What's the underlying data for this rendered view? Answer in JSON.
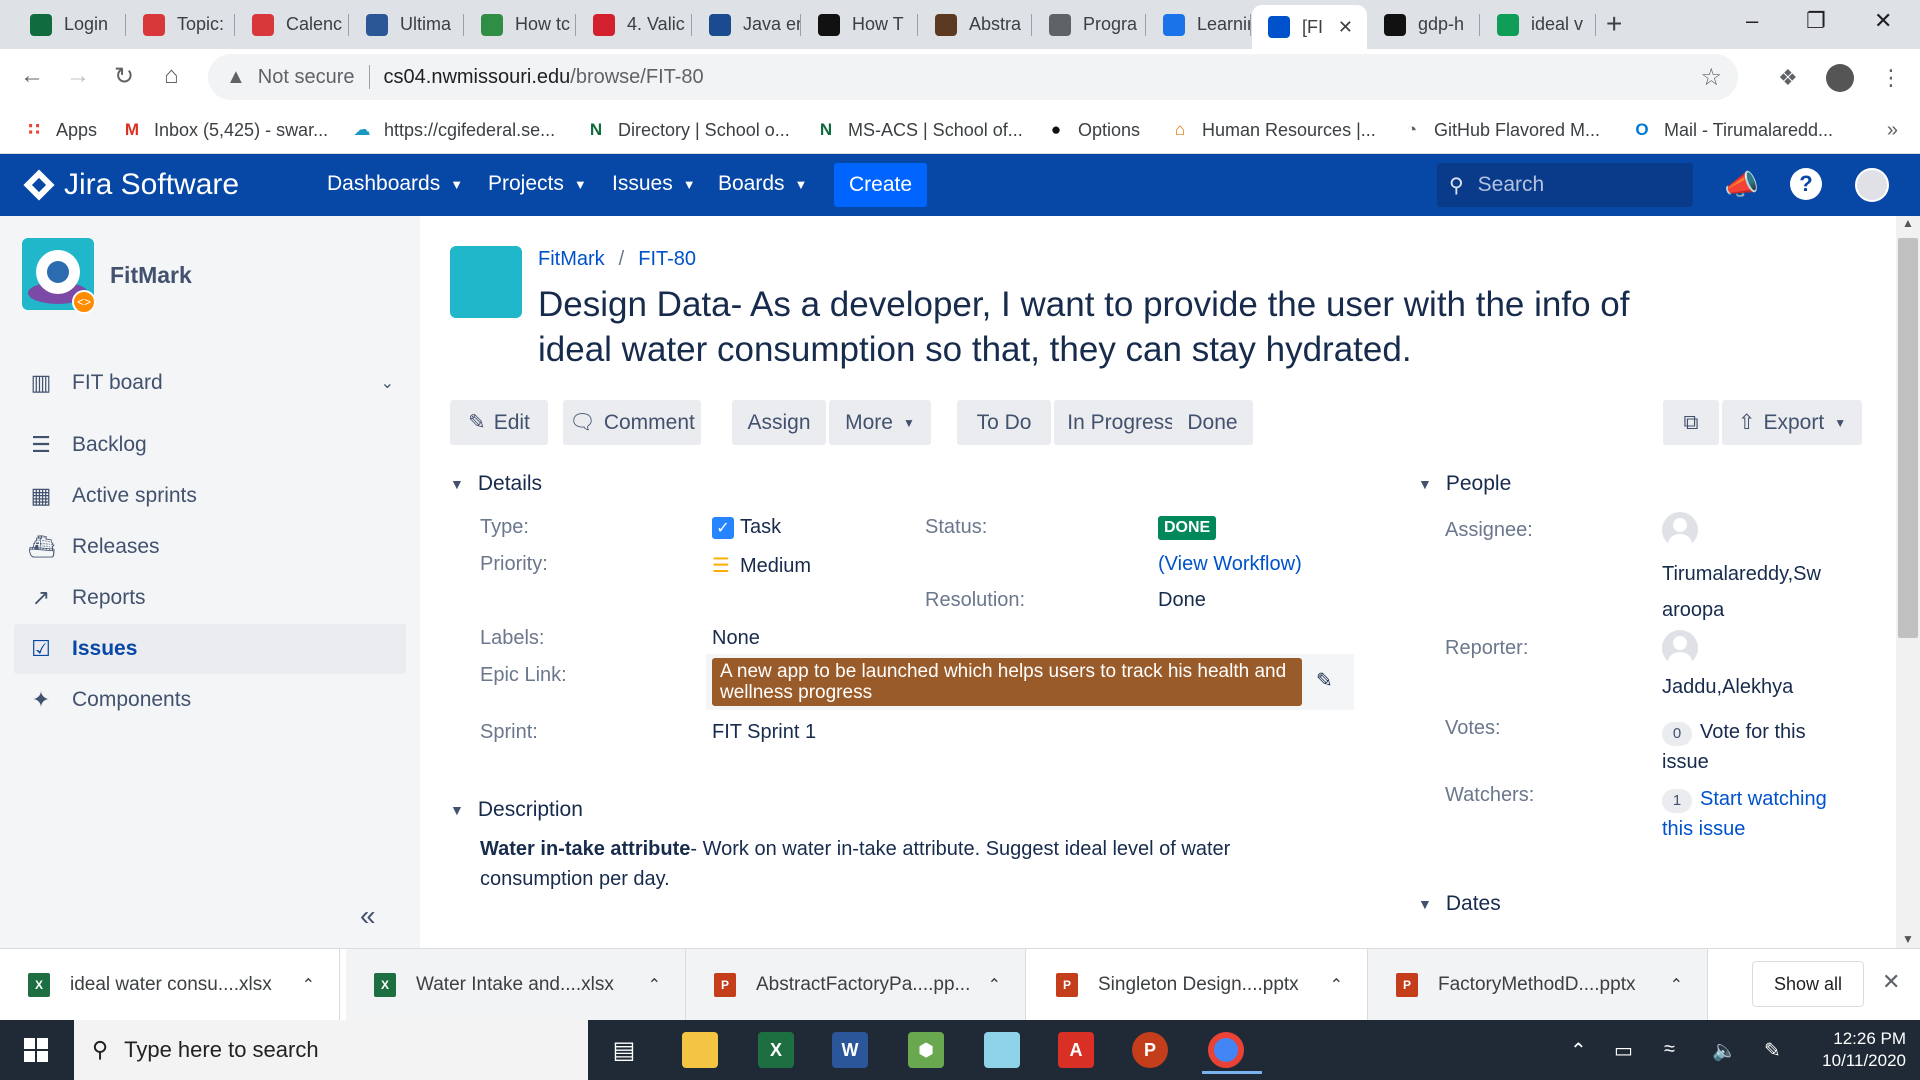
{
  "browser": {
    "tabs": [
      {
        "title": "Login",
        "icon": "notion-icon",
        "color": "#106b3d"
      },
      {
        "title": "Topic:",
        "icon": "northwest-icon",
        "color": "#d9383b"
      },
      {
        "title": "Calenc",
        "icon": "northwest-icon",
        "color": "#d9383b"
      },
      {
        "title": "Ultima",
        "icon": "atom-icon",
        "color": "#2b5797"
      },
      {
        "title": "How tc",
        "icon": "geeks-icon",
        "color": "#2f8d46"
      },
      {
        "title": "4. Valic",
        "icon": "opera-icon",
        "color": "#d3202f"
      },
      {
        "title": "Java er",
        "icon": "app-icon",
        "color": "#1b4b8f"
      },
      {
        "title": "How T",
        "icon": "heart-icon",
        "color": "#111111"
      },
      {
        "title": "Abstra",
        "icon": "dragon-icon",
        "color": "#5c3a21"
      },
      {
        "title": "Progra",
        "icon": "globe-icon",
        "color": "#5f6368"
      },
      {
        "title": "Learnir",
        "icon": "dot-icon",
        "color": "#1a73e8"
      },
      {
        "title": "[FI",
        "icon": "jira-icon",
        "color": "#0052cc"
      },
      {
        "title": "gdp-h",
        "icon": "github-icon",
        "color": "#111111"
      },
      {
        "title": "ideal v",
        "icon": "sheets-icon",
        "color": "#0f9d58"
      }
    ],
    "new_tab": "+",
    "url_warning": "Not secure",
    "url_host": "cs04.nwmissouri.edu",
    "url_path": "/browse/FIT-80",
    "bookmarks": [
      {
        "label": "Apps",
        "icon": "apps-grid-icon",
        "color": "#ea4335"
      },
      {
        "label": "Inbox (5,425) - swar...",
        "icon": "gmail-icon",
        "color": "#d93025"
      },
      {
        "label": "https://cgifederal.se...",
        "icon": "salesforce-icon",
        "color": "#1798c1"
      },
      {
        "label": "Directory | School o...",
        "icon": "n-icon",
        "color": "#106b3d"
      },
      {
        "label": "MS-ACS | School of...",
        "icon": "n-icon",
        "color": "#106b3d"
      },
      {
        "label": "Options",
        "icon": "github-icon",
        "color": "#111111"
      },
      {
        "label": "Human Resources |...",
        "icon": "hr-icon",
        "color": "#e8710a"
      },
      {
        "label": "GitHub Flavored M...",
        "icon": "globe-icon",
        "color": "#5f6368"
      },
      {
        "label": "Mail - Tirumalaredd...",
        "icon": "outlook-icon",
        "color": "#0078d4"
      }
    ]
  },
  "jira": {
    "brand": "Jira Software",
    "nav": [
      "Dashboards",
      "Projects",
      "Issues",
      "Boards"
    ],
    "create": "Create",
    "search_placeholder": "Search",
    "colors": {
      "header": "#0747a6",
      "create": "#0065ff",
      "done": "#00875a",
      "epic": "#9a5b2a"
    }
  },
  "sidebar": {
    "project": "FitMark",
    "items": [
      {
        "label": "FIT board",
        "icon": "board-icon"
      },
      {
        "label": "Backlog",
        "icon": "backlog-icon"
      },
      {
        "label": "Active sprints",
        "icon": "sprint-board-icon"
      },
      {
        "label": "Releases",
        "icon": "ship-icon"
      },
      {
        "label": "Reports",
        "icon": "chart-icon"
      },
      {
        "label": "Issues",
        "icon": "issues-icon",
        "selected": true
      },
      {
        "label": "Components",
        "icon": "puzzle-icon"
      }
    ]
  },
  "issue": {
    "project": "FitMark",
    "key": "FIT-80",
    "summary": "Design Data- As a developer, I want to provide the user with the info of ideal water consumption so that, they can stay hydrated.",
    "ops": {
      "edit": "Edit",
      "comment": "Comment",
      "assign": "Assign",
      "more": "More",
      "todo": "To Do",
      "inprogress": "In Progress",
      "done": "Done",
      "export": "Export"
    },
    "details": {
      "heading": "Details",
      "type_label": "Type:",
      "type": "Task",
      "priority_label": "Priority:",
      "priority": "Medium",
      "status_label": "Status:",
      "status": "DONE",
      "workflow": "(View Workflow)",
      "resolution_label": "Resolution:",
      "resolution": "Done",
      "labels_label": "Labels:",
      "labels": "None",
      "epic_label": "Epic Link:",
      "epic": "A new app to be launched which helps users to track his health and wellness progress",
      "sprint_label": "Sprint:",
      "sprint": "FIT Sprint 1"
    },
    "description": {
      "heading": "Description",
      "bold": "Water in-take attribute",
      "text": "- Work on water in-take attribute. Suggest ideal level of water consumption per day."
    },
    "people": {
      "heading": "People",
      "assignee_label": "Assignee:",
      "assignee": "Tirumalareddy,Swaroopa",
      "reporter_label": "Reporter:",
      "reporter": "Jaddu,Alekhya",
      "votes_label": "Votes:",
      "votes": "0",
      "vote_text": "Vote for this issue",
      "watchers_label": "Watchers:",
      "watchers": "1",
      "watch_text": "Start watching this issue"
    },
    "dates_heading": "Dates"
  },
  "downloads": {
    "items": [
      {
        "name": "ideal water consu....xlsx",
        "color": "#1d6f42"
      },
      {
        "name": "Water Intake and....xlsx",
        "color": "#1d6f42"
      },
      {
        "name": "AbstractFactoryPa....pp...",
        "color": "#c43e1c"
      },
      {
        "name": "Singleton Design....pptx",
        "color": "#c43e1c"
      },
      {
        "name": "FactoryMethodD....pptx",
        "color": "#c43e1c"
      }
    ],
    "show_all": "Show all"
  },
  "taskbar": {
    "search_placeholder": "Type here to search",
    "time": "12:26 PM",
    "date": "10/11/2020"
  }
}
